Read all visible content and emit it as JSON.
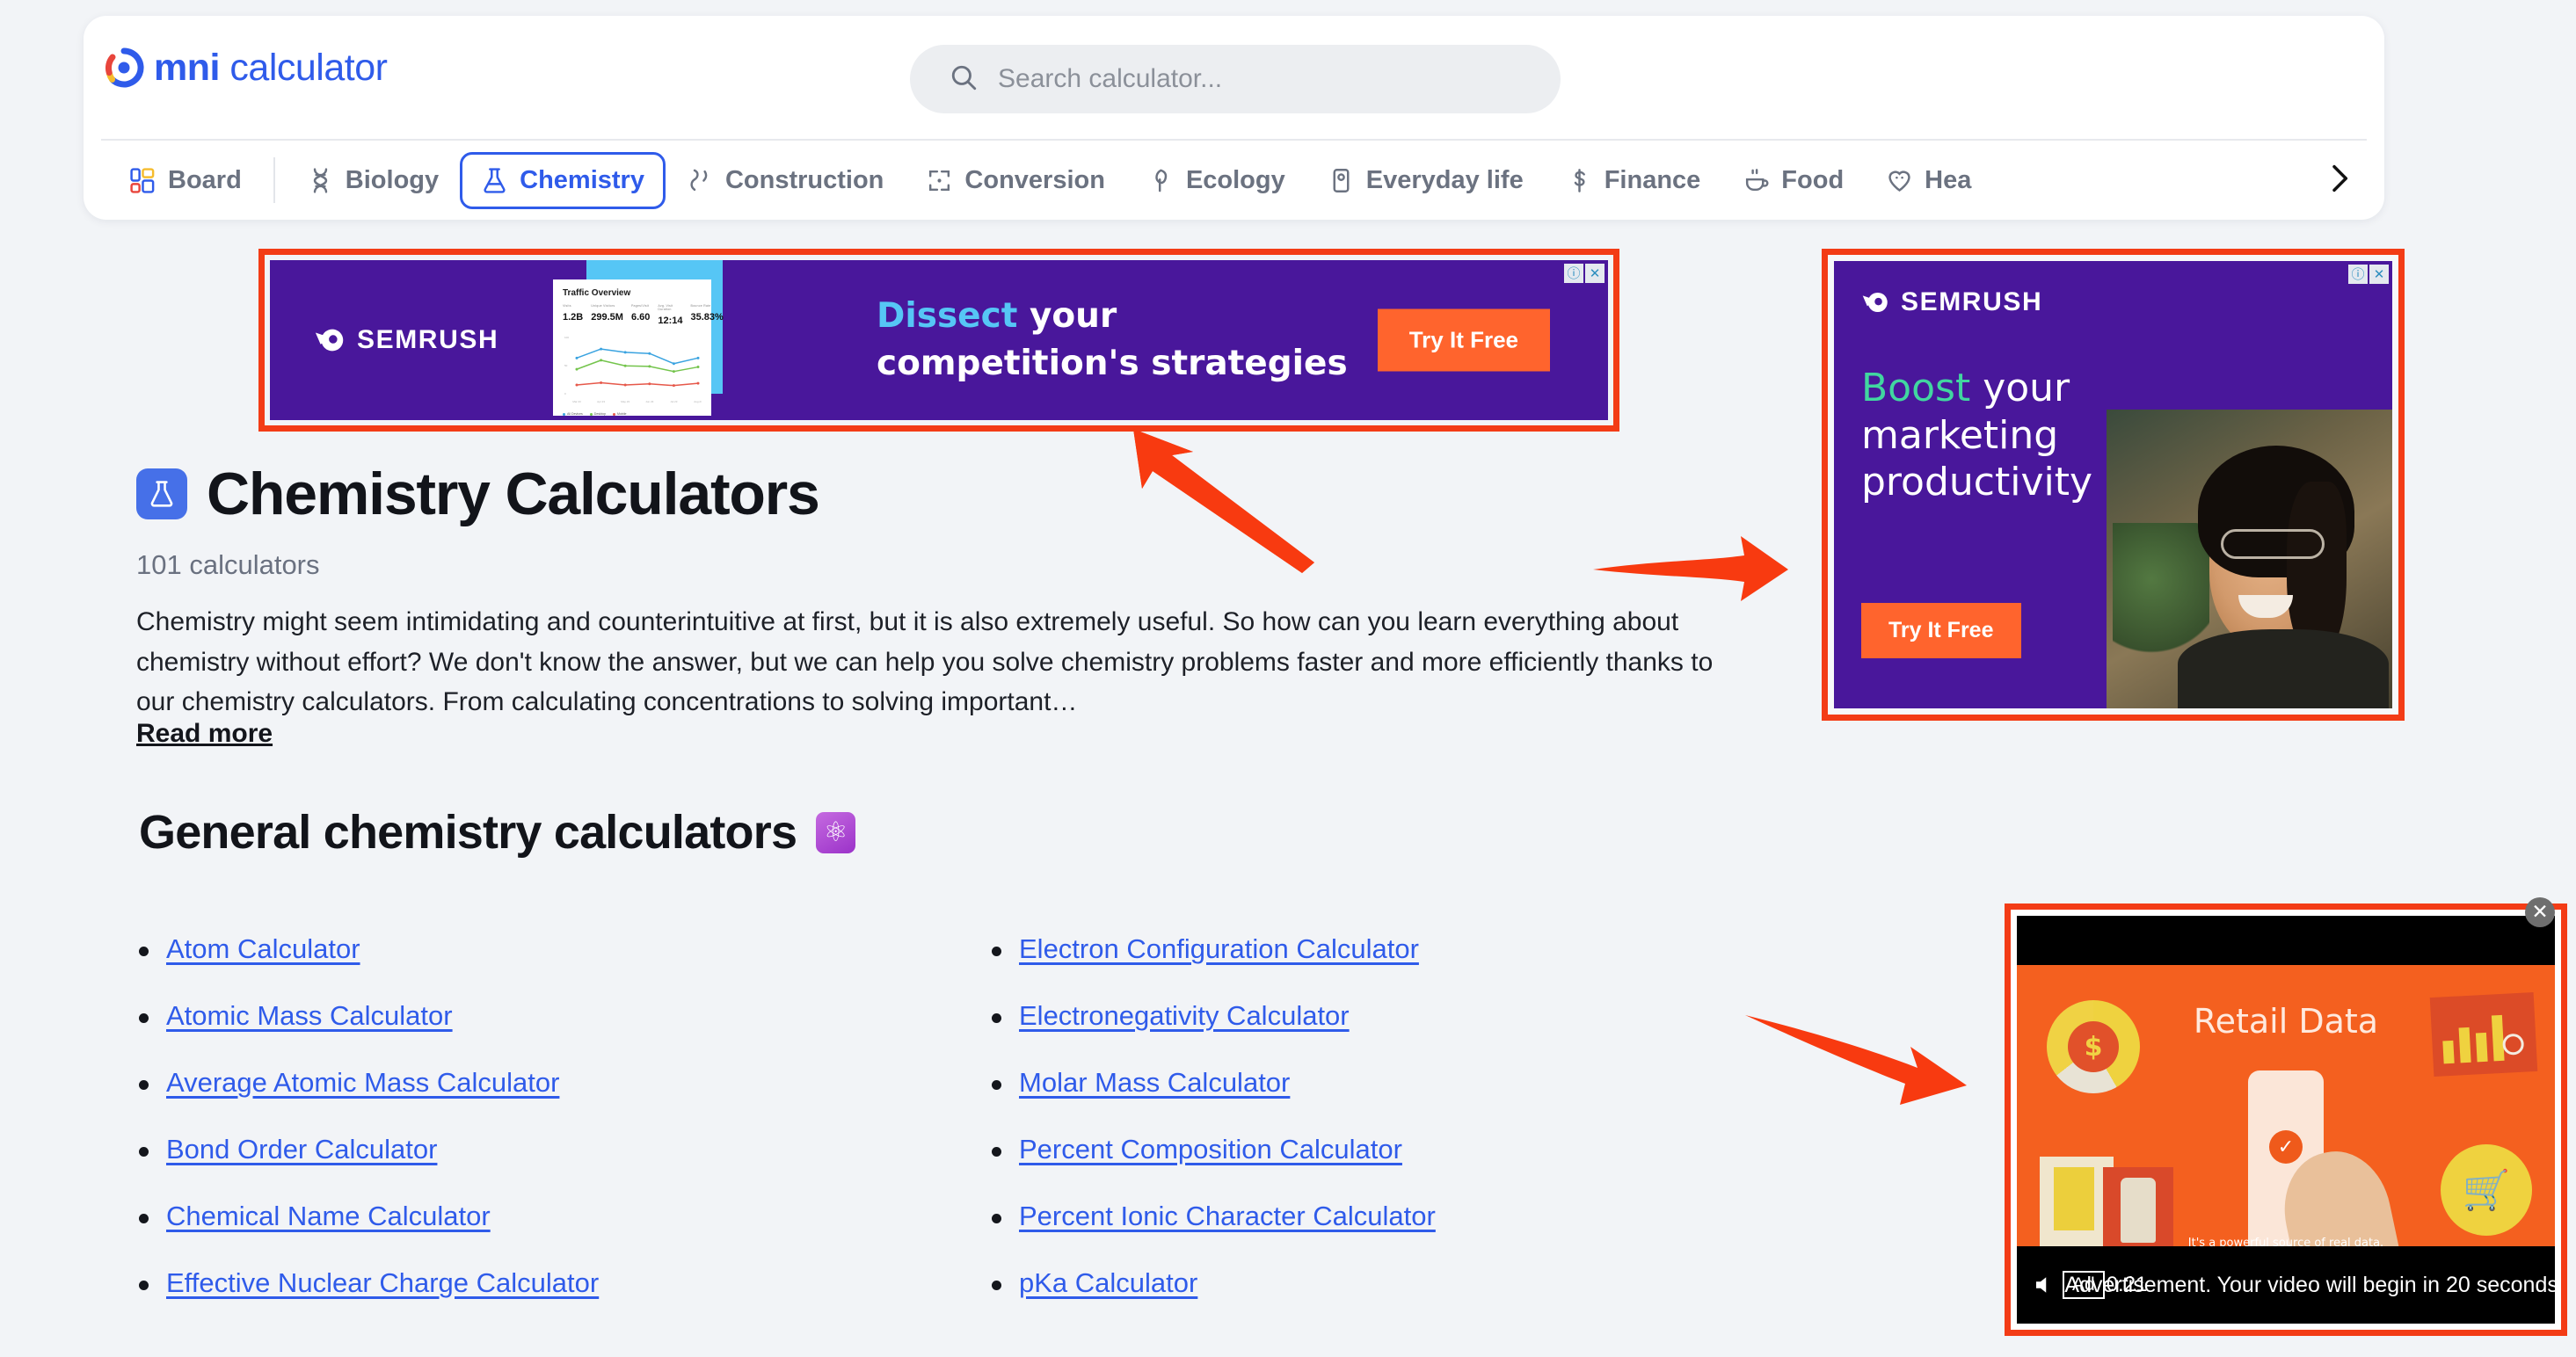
{
  "brand": {
    "name_bold": "mni",
    "name_light": "calculator",
    "logo_colors": {
      "blue": "#2f5bea",
      "red": "#e8453c",
      "yellow": "#f5bc2e"
    }
  },
  "search": {
    "placeholder": "Search calculator...",
    "icon": "search-icon"
  },
  "nav": {
    "items": [
      {
        "label": "Board",
        "icon": "board-icon",
        "active": false
      },
      {
        "label": "Biology",
        "icon": "dna-icon",
        "active": false
      },
      {
        "label": "Chemistry",
        "icon": "flask-icon",
        "active": true
      },
      {
        "label": "Construction",
        "icon": "pipe-icon",
        "active": false
      },
      {
        "label": "Conversion",
        "icon": "conversion-icon",
        "active": false
      },
      {
        "label": "Ecology",
        "icon": "tree-icon",
        "active": false
      },
      {
        "label": "Everyday life",
        "icon": "phone-icon",
        "active": false
      },
      {
        "label": "Finance",
        "icon": "dollar-icon",
        "active": false
      },
      {
        "label": "Food",
        "icon": "cup-icon",
        "active": false
      },
      {
        "label": "Hea",
        "icon": "heart-icon",
        "active": false
      }
    ],
    "scroll_next_icon": "chevron-right-icon"
  },
  "ads": {
    "top_banner": {
      "brand": "SEMRUSH",
      "headline_highlight": "Dissect",
      "headline_rest": " your",
      "headline_line2": "competition's strategies",
      "cta": "Try It Free",
      "info_icon": "info-icon",
      "close_icon": "close-icon",
      "card": {
        "title": "Traffic Overview",
        "stats": [
          {
            "label": "Visits",
            "value": "1.2B"
          },
          {
            "label": "Unique Visitors",
            "value": "299.5M"
          },
          {
            "label": "Pages/Visit",
            "value": "6.60"
          },
          {
            "label": "Avg. Visit Duration",
            "value": "12:14"
          },
          {
            "label": "Bounce Rate",
            "value": "35.83%"
          }
        ],
        "legend": [
          "All Devices",
          "Desktop",
          "Mobile"
        ]
      }
    },
    "side_banner": {
      "brand": "SEMRUSH",
      "headline_highlight": "Boost",
      "headline_rest": " your",
      "headline_line2": "marketing",
      "headline_line3": "productivity",
      "cta": "Try It Free",
      "info_icon": "info-icon",
      "close_icon": "close-icon"
    },
    "video_popup": {
      "title": "Retail Data",
      "subtitle": "It's a powerful source of real data.",
      "status": "Advertisement. Your video will begin in 20 seconds.",
      "ad_badge": "Ad",
      "timer": "0:21",
      "close_icon": "close-icon",
      "mute_icon": "mute-icon"
    }
  },
  "page": {
    "title": "Chemistry Calculators",
    "title_icon": "flask-icon",
    "count": "101 calculators",
    "description": "Chemistry might seem intimidating and counterintuitive at first, but it is also extremely useful. So how can you learn everything about chemistry without effort? We don't know the answer, but we can help you solve chemistry problems faster and more efficiently thanks to our chemistry calculators. From calculating concentrations to solving important…",
    "read_more": "Read more"
  },
  "section": {
    "title": "General chemistry calculators",
    "emoji": "⚛",
    "emoji_name": "atom-emoji",
    "left_column": [
      "Atom Calculator",
      "Atomic Mass Calculator",
      "Average Atomic Mass Calculator",
      "Bond Order Calculator",
      "Chemical Name Calculator",
      "Effective Nuclear Charge Calculator"
    ],
    "right_column": [
      "Electron Configuration Calculator",
      "Electronegativity Calculator",
      "Molar Mass Calculator",
      "Percent Composition Calculator",
      "Percent Ionic Character Calculator",
      "pKa Calculator"
    ]
  },
  "annotations": {
    "arrow_color": "#f33c16",
    "highlight_color": "#f33c16",
    "arrows": [
      {
        "name": "arrow-to-top-banner-ad"
      },
      {
        "name": "arrow-to-side-banner-ad"
      },
      {
        "name": "arrow-to-video-popup-ad"
      }
    ]
  },
  "chart_data": {
    "type": "line",
    "title": "Traffic Overview",
    "x": [
      "Mar 23",
      "Apr 23",
      "May 23",
      "Jun 23",
      "Jul 23",
      "Aug 23"
    ],
    "series": [
      {
        "name": "All Devices",
        "color": "#3aa3e0",
        "values": [
          62,
          78,
          72,
          70,
          52,
          62
        ]
      },
      {
        "name": "Desktop",
        "color": "#74c44c",
        "values": [
          42,
          58,
          48,
          47,
          38,
          46
        ]
      },
      {
        "name": "Mobile",
        "color": "#e6584a",
        "values": [
          14,
          18,
          14,
          16,
          13,
          17
        ]
      }
    ],
    "ylim": [
      0,
      100
    ],
    "grid": false,
    "legend_position": "bottom"
  }
}
